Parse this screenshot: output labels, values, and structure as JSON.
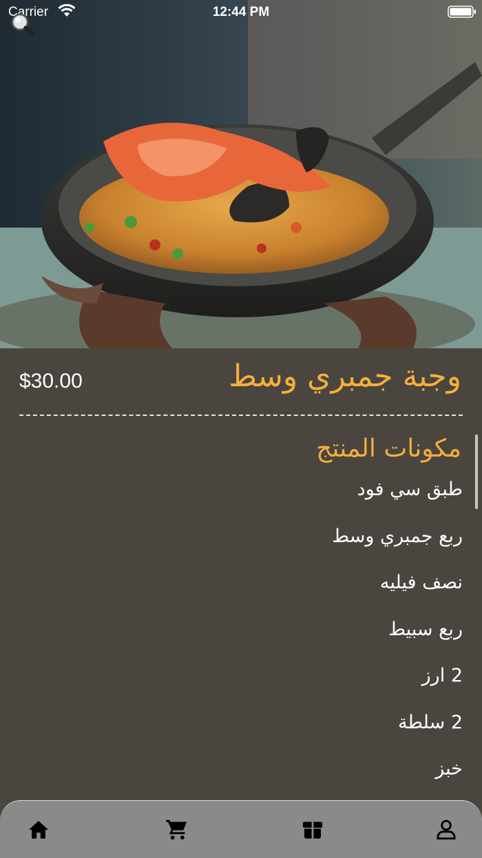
{
  "status_bar": {
    "carrier": "Carrier",
    "time": "12:44 PM"
  },
  "hero": {
    "icon": "zoom-icon"
  },
  "product": {
    "title": "وجبة جمبري وسط",
    "price": "$30.00"
  },
  "ingredients_section": {
    "title": "مكونات المنتج",
    "items": [
      "طبق سي فود",
      "ربع جمبري وسط",
      "نصف فيليه",
      "ربع سبيط",
      "2 ارز",
      "2 سلطة",
      "خبز"
    ]
  },
  "tab_bar": {
    "tabs": [
      {
        "icon": "home-icon"
      },
      {
        "icon": "cart-icon"
      },
      {
        "icon": "box-icon"
      },
      {
        "icon": "profile-icon"
      }
    ]
  },
  "colors": {
    "accent": "#f5b03a",
    "background": "#4a453f",
    "tab_bar": "#8a8a8a"
  }
}
